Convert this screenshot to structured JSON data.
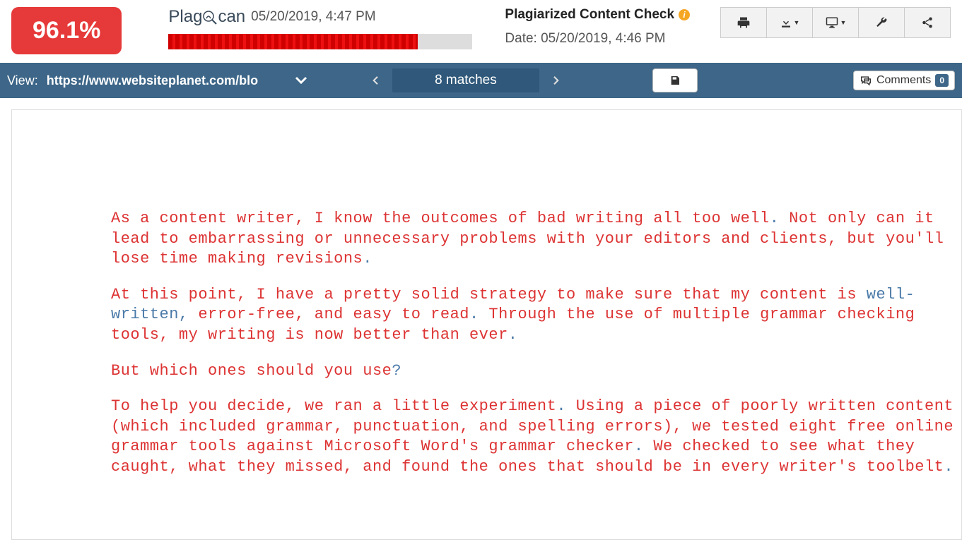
{
  "header": {
    "percentage": "96.1%",
    "logo_plag": "Plag",
    "logo_scan": "can",
    "scan_timestamp": "05/20/2019, 4:47 PM",
    "progress_percent": 82,
    "title": "Plagiarized Content Check",
    "date_label": "Date: 05/20/2019, 4:46 PM"
  },
  "navbar": {
    "view_label": "View:",
    "view_url": "https://www.websiteplanet.com/blo",
    "matches": "8 matches",
    "comments_label": "Comments",
    "comments_count": "0"
  },
  "doc": {
    "p1a": "As a content writer, I know the outcomes of bad writing all too well",
    "p1b": " Not only can it lead to embarrassing or unnecessary problems with your editors and clients, but you'll lose time making revisions",
    "p2a": "At this point, I have a pretty solid strategy to make sure that my content is ",
    "p2_hl": "well-written,",
    "p2b": " error-free, and easy to read",
    "p2c": " Through the use of multiple grammar checking tools, my writing is now better than ever",
    "p3": "But which ones should you use",
    "p4a": "To help you decide, we ran a little experiment",
    "p4b": " Using a piece of poorly written content (which included grammar, punctuation, and spelling errors), we tested eight free online grammar tools against Microsoft Word's grammar checker",
    "p4c": " We checked to see what they caught, what they missed, and found the ones that should be in every writer's toolbelt",
    "dot": ".",
    "qmark": "?"
  }
}
